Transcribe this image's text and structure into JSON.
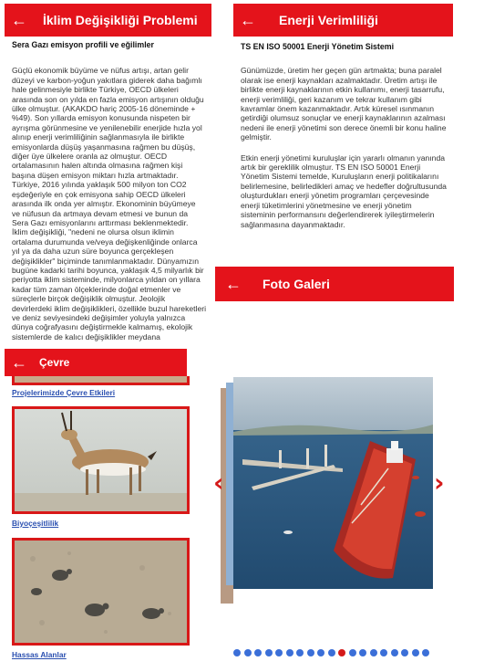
{
  "climate": {
    "title": "İklim Değişikliği Problemi",
    "subtitle": "Sera Gazı emisyon profili ve eğilimler",
    "paragraph": "Güçlü ekonomik büyüme ve nüfus artışı, artan gelir düzeyi ve karbon-yoğun yakıtlara giderek daha bağımlı hale gelinmesiyle birlikte Türkiye, OECD ülkeleri arasında son on yılda en fazla emisyon artışının olduğu ülke olmuştur. (AKAKDO hariç 2005-16 döneminde + %49). Son yıllarda emisyon konusunda nispeten bir ayrışma görünmesine ve yenilenebilir enerjide hızla yol alınıp enerji verimliliğinin sağlanmasıyla ile birlikte emisyonlarda düşüş yaşanmasına rağmen bu düşüş, diğer üye ülkelere oranla az olmuştur. OECD ortalamasının halen altında olmasına rağmen kişi başına düşen emisyon miktarı hızla artmaktadır. Türkiye, 2016 yılında yaklaşık 500 milyon ton CO2 eşdeğeriyle en çok emisyona sahip OECD ülkeleri arasında ilk onda yer almıştır. Ekonominin büyümeye ve nüfusun da artmaya devam etmesi ve bunun da Sera Gazı emisyonlarını arttırması beklenmektedir. İklim değişikliği, \"nedeni ne olursa olsun iklimin ortalama durumunda ve/veya değişkenliğinde onlarca yıl ya da daha uzun süre boyunca gerçekleşen değişiklikler\" biçiminde tanımlanmaktadır. Dünyamızın bugüne kadarki tarihi boyunca, yaklaşık 4,5 milyarlık bir periyotta iklim sisteminde, milyonlarca yıldan on yıllara kadar tüm zaman ölçeklerinde doğal etmenler ve süreçlerle birçok değişiklik olmuştur. Jeolojik devirlerdeki iklim değişiklikleri, özellikle buzul hareketleri ve deniz seviyesindeki değişimler yoluyla yalnızca dünya coğrafyasını değiştirmekle kalmamış, ekolojik sistemlerde de kalıcı değişiklikler meydana"
  },
  "energy": {
    "title": "Enerji Verimliliği",
    "subtitle": "TS EN ISO 50001 Enerji Yönetim Sistemi",
    "paragraph1": "Günümüzde, üretim her geçen gün artmakta; buna paralel olarak ise enerji kaynakları azalmaktadır. Üretim artışı ile birlikte enerji kaynaklarının etkin kullanımı, enerji tasarrufu, enerji verimliliği, geri kazanım ve tekrar kullanım gibi kavramlar önem kazanmaktadır. Artık küresel ısınmanın getirdiği olumsuz sonuçlar ve enerji kaynaklarının azalması nedeni ile enerji yönetimi son derece önemli bir konu haline gelmiştir.",
    "paragraph2": "Etkin enerji yönetimi kuruluşlar için yararlı olmanın yanında artık bir gereklilik olmuştur. TS EN ISO 50001 Enerji Yönetim Sistemi temelde, Kuruluşların enerji politikalarını belirlemesine, belirledikleri amaç ve hedefler doğrultusunda oluşturdukları enerji yönetim programları çerçevesinde enerji tüketimlerini yönetmesine ve enerji yönetim sisteminin performansını değerlendirerek iyileştirmelerin sağlanmasına dayanmaktadır."
  },
  "environment": {
    "title": "Çevre",
    "items": [
      {
        "label": "Projelerimizde Çevre Etkileri"
      },
      {
        "label": "Biyoçeşitlilik"
      },
      {
        "label": "Hassas Alanlar"
      }
    ]
  },
  "gallery": {
    "title": "Foto Galeri",
    "prev_glyph": "‹",
    "next_glyph": "›",
    "dot_count": 19,
    "active_dot_index": 10
  },
  "icons": {
    "back": "←"
  },
  "colors": {
    "brand_red": "#e4131b",
    "link_blue": "#2a4fb0",
    "dot_blue": "#3b6fd8"
  }
}
